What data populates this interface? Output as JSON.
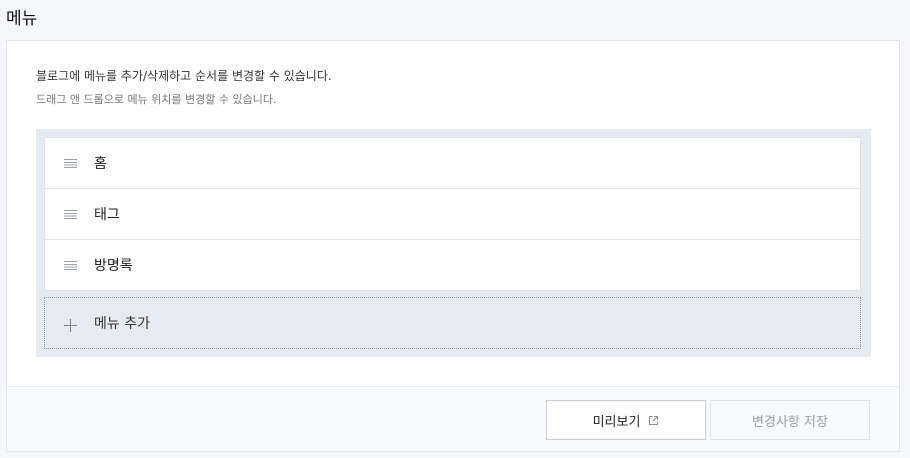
{
  "page": {
    "title": "메뉴"
  },
  "description": {
    "main": "블로그에 메뉴를 추가/삭제하고 순서를 변경할 수 있습니다.",
    "sub": "드래그 앤 드롭으로 메뉴 위치를 변경할 수 있습니다."
  },
  "menu": {
    "items": [
      {
        "label": "홈",
        "icon": "drag-handle-icon"
      },
      {
        "label": "태그",
        "icon": "drag-handle-icon"
      },
      {
        "label": "방명록",
        "icon": "drag-handle-icon"
      }
    ],
    "add_label": "메뉴 추가",
    "add_icon": "plus-icon"
  },
  "footer": {
    "preview_label": "미리보기",
    "preview_icon": "external-link-icon",
    "save_label": "변경사항 저장"
  },
  "colors": {
    "menu_area_bg": "#e6eaf1",
    "save_disabled_text": "#9a9fa6"
  }
}
